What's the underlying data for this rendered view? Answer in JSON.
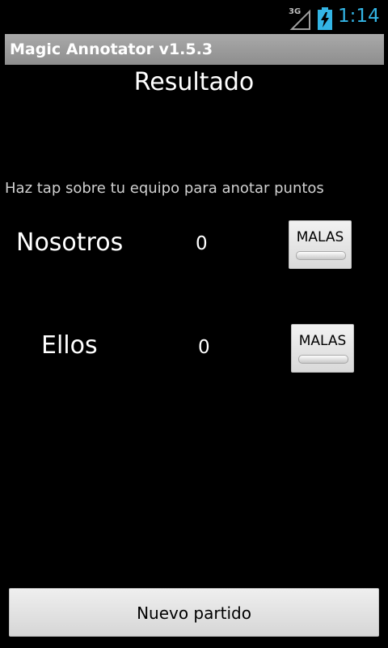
{
  "status_bar": {
    "network_label": "3G",
    "time": "1:14",
    "time_color": "#33b5e5",
    "icons": [
      "signal-icon",
      "battery-charging-icon"
    ]
  },
  "title_bar": {
    "title": "Magic Annotator v1.5.3"
  },
  "main": {
    "heading": "Resultado",
    "hint": "Haz tap sobre tu equipo para anotar puntos",
    "teams": [
      {
        "name": "Nosotros",
        "score": "0",
        "button_label": "MALAS"
      },
      {
        "name": "Ellos",
        "score": "0",
        "button_label": "MALAS"
      }
    ]
  },
  "footer": {
    "new_game_label": "Nuevo partido"
  }
}
